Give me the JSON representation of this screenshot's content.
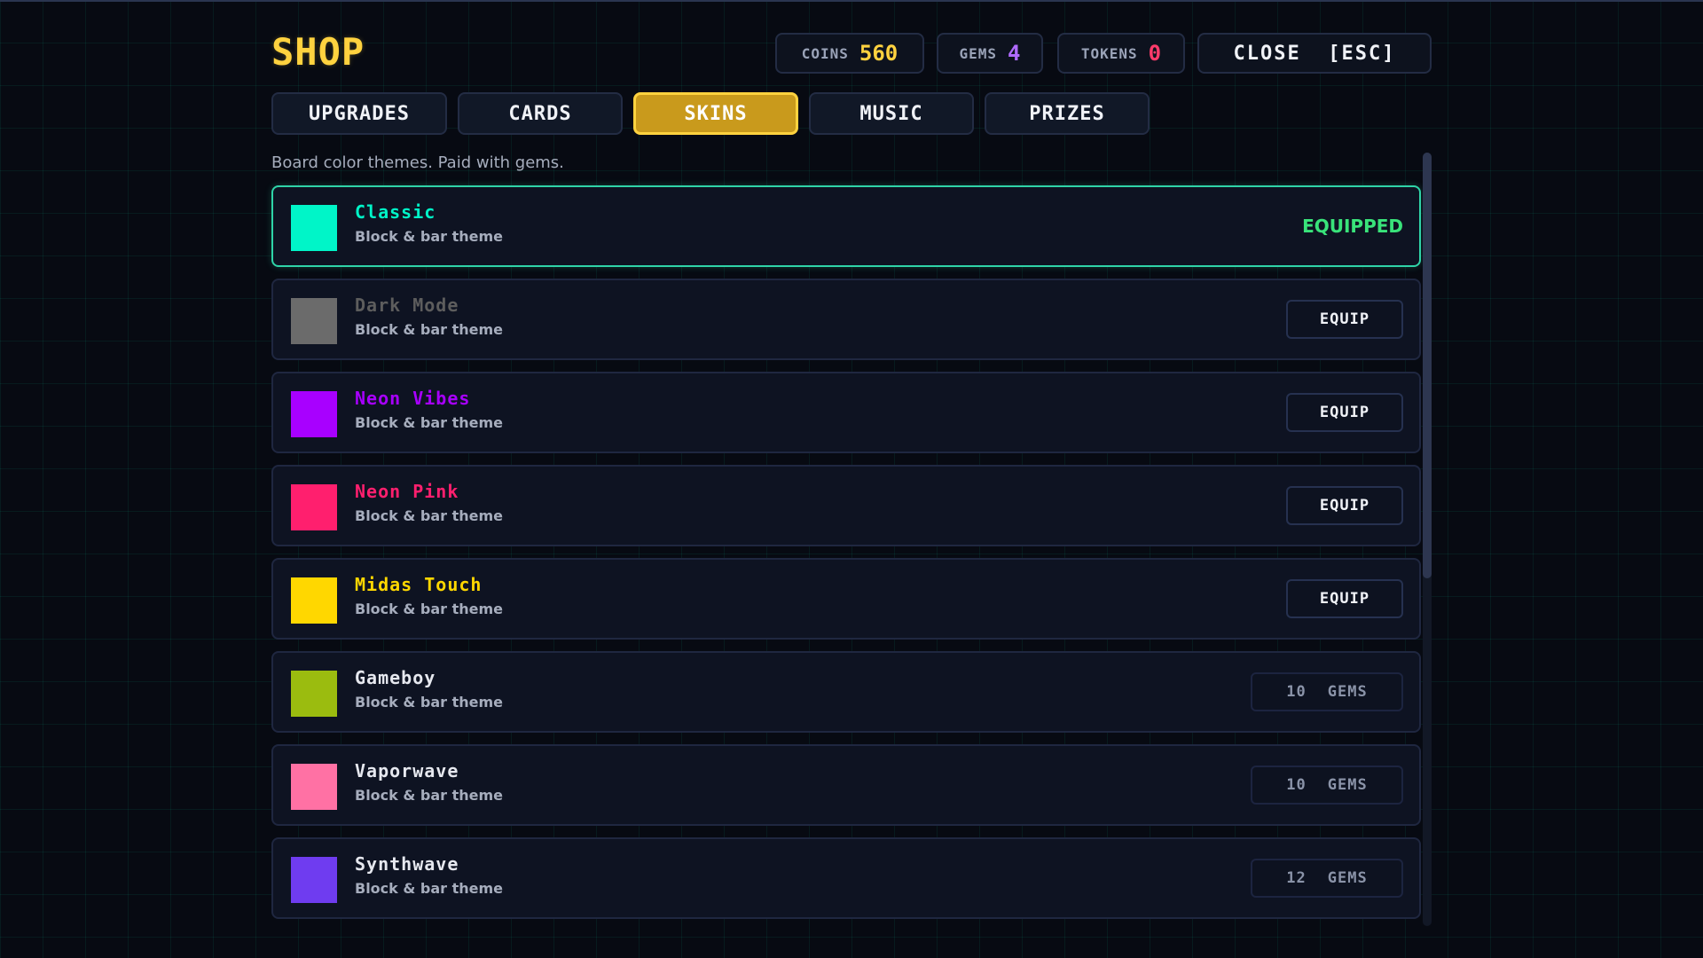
{
  "header": {
    "title": "SHOP",
    "close_label": "CLOSE  [ESC]"
  },
  "stats": {
    "coins": {
      "label": "COINS",
      "value": "560",
      "color": "#ffd23f"
    },
    "gems": {
      "label": "GEMS",
      "value": "4",
      "color": "#b06bff"
    },
    "tokens": {
      "label": "TOKENS",
      "value": "0",
      "color": "#ff3b6b"
    }
  },
  "tabs": [
    {
      "label": "UPGRADES",
      "active": false
    },
    {
      "label": "CARDS",
      "active": false
    },
    {
      "label": "SKINS",
      "active": true
    },
    {
      "label": "MUSIC",
      "active": false
    },
    {
      "label": "PRIZES",
      "active": false
    }
  ],
  "subtitle": "Board color themes. Paid with gems.",
  "skins": [
    {
      "name": "Classic",
      "desc": "Block & bar theme",
      "color": "#00f5c8",
      "name_color": "#00f5c8",
      "state": "equipped",
      "action": "EQUIPPED"
    },
    {
      "name": "Dark Mode",
      "desc": "Block & bar theme",
      "color": "#6b6b6b",
      "name_color": "#5d5d5d",
      "state": "owned",
      "action": "EQUIP"
    },
    {
      "name": "Neon Vibes",
      "desc": "Block & bar theme",
      "color": "#a800ff",
      "name_color": "#a800ff",
      "state": "owned",
      "action": "EQUIP"
    },
    {
      "name": "Neon Pink",
      "desc": "Block & bar theme",
      "color": "#ff1f6e",
      "name_color": "#ff1f6e",
      "state": "owned",
      "action": "EQUIP"
    },
    {
      "name": "Midas Touch",
      "desc": "Block & bar theme",
      "color": "#ffd700",
      "name_color": "#ffd700",
      "state": "owned",
      "action": "EQUIP"
    },
    {
      "name": "Gameboy",
      "desc": "Block & bar theme",
      "color": "#9bbc0f",
      "name_color": "#e6e8ef",
      "state": "locked",
      "price": "10",
      "currency": "GEMS"
    },
    {
      "name": "Vaporwave",
      "desc": "Block & bar theme",
      "color": "#ff71a4",
      "name_color": "#e6e8ef",
      "state": "locked",
      "price": "10",
      "currency": "GEMS"
    },
    {
      "name": "Synthwave",
      "desc": "Block & bar theme",
      "color": "#6f3cf0",
      "name_color": "#e6e8ef",
      "state": "locked",
      "price": "12",
      "currency": "GEMS"
    }
  ]
}
